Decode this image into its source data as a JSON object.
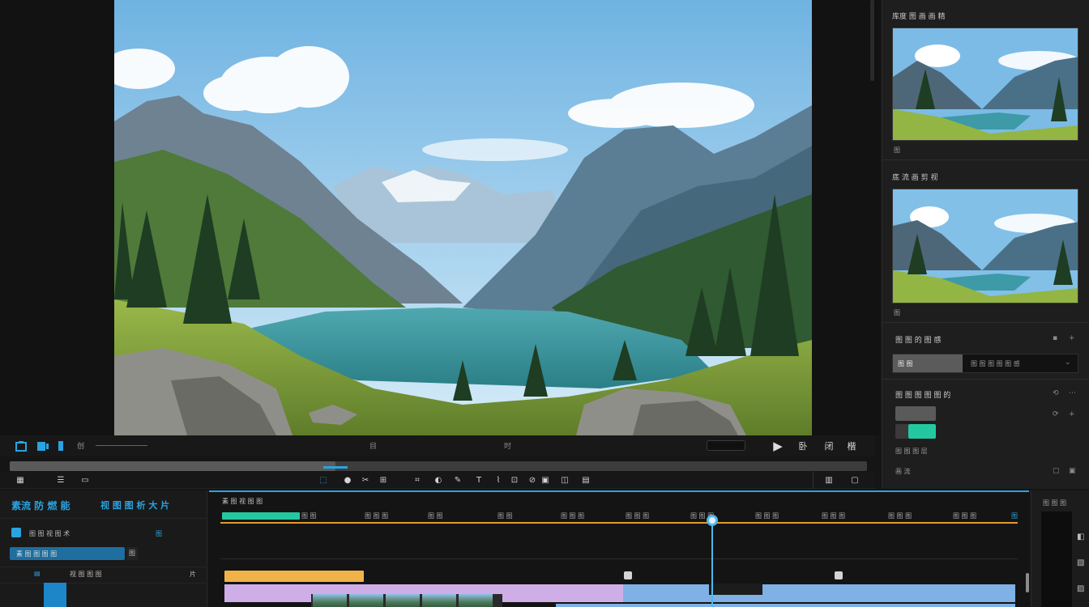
{
  "transport": {
    "icons_left": [
      "import-icon",
      "media-icon",
      "marker-icon"
    ],
    "time_small": "创",
    "timecode_center_a": "目",
    "timecode_center_b": "时",
    "play_symbol": "▶",
    "btn_a": "卧",
    "btn_b": "闭",
    "btn_c": "楷"
  },
  "scrub": {
    "progress": 0.38
  },
  "right_panel": {
    "preset_a_label": "库度 图 画 画 精",
    "preset_a_sub": "图",
    "preset_b_label": "底 流 画 剪 视",
    "preset_b_sub": "图",
    "section_label": "图 图 的 图 感",
    "dropdown_selected": "图 图",
    "dropdown_value": "图 图 图 图 图 感",
    "effects_label": "图 图 图 图 图 的",
    "effects_sub": "图 图 图 层",
    "effects_sub2": "画 流"
  },
  "project": {
    "title": "素流 防 燃 能",
    "title_right": "视 图 图 析 大   片",
    "row1_label": "图 图 视 图 术",
    "row1_icon": "图",
    "input_label": "素 图 图 图 图",
    "input_btn": "图",
    "row3_label": "视 图 图 图",
    "row3_icon": "片"
  },
  "timeline": {
    "head_label": "素 图 视 图 图",
    "ticks": [
      "图 图",
      "图 图 图",
      "图 图",
      "图 图",
      "图 图 图",
      "图 图 图",
      "图 图 图",
      "图 图 图",
      "图 图 图",
      "图 图 图",
      "图 图 图",
      "图"
    ]
  },
  "strip": {
    "label": "图 图 图"
  },
  "colors": {
    "accent": "#2aa3e0",
    "green": "#24c8a0",
    "orange": "#f1b248",
    "violet": "#cfaee8",
    "blue_clip": "#7fb0e6"
  }
}
